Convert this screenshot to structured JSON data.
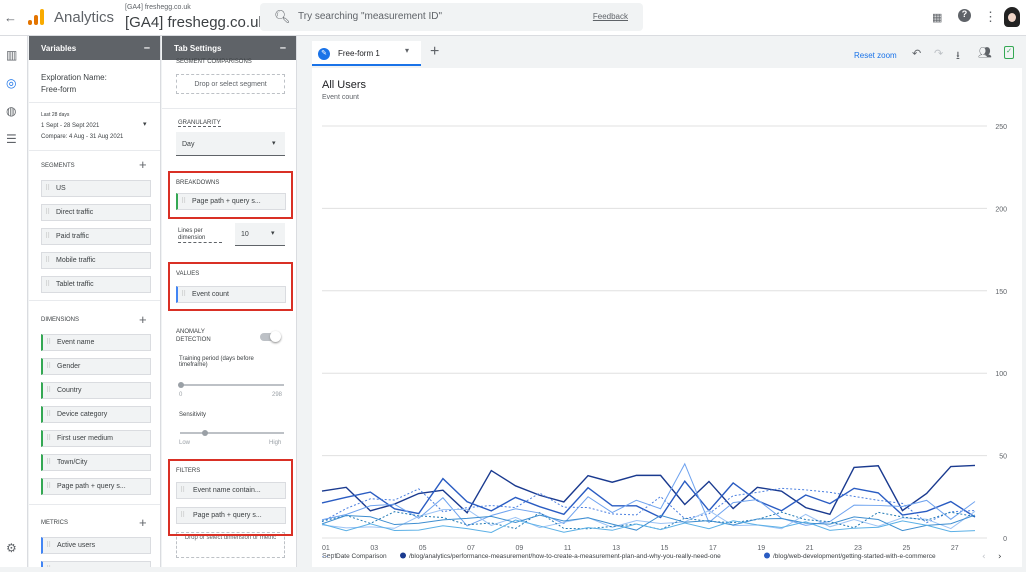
{
  "header": {
    "app_name": "Analytics",
    "account_small": "[GA4] freshegg.co.uk",
    "account": "[GA4] freshegg.co.uk",
    "search_placeholder": "Try searching \"measurement ID\"",
    "feedback": "Feedback"
  },
  "variables": {
    "title": "Variables",
    "exploration_label": "Exploration Name:",
    "exploration_value": "Free-form",
    "date_preset": "Last 28 days",
    "date_range": "1 Sept - 28 Sept 2021",
    "compare": "Compare: 4 Aug - 31 Aug 2021",
    "segments_title": "SEGMENTS",
    "segments": [
      "US",
      "Direct traffic",
      "Paid traffic",
      "Mobile traffic",
      "Tablet traffic"
    ],
    "dimensions_title": "DIMENSIONS",
    "dimensions": [
      "Event name",
      "Gender",
      "Country",
      "Device category",
      "First user medium",
      "Town/City",
      "Page path + query s..."
    ],
    "metrics_title": "METRICS",
    "metrics": [
      "Active users"
    ]
  },
  "tab_settings": {
    "title": "Tab Settings",
    "segment_comparisons": "SEGMENT COMPARISONS",
    "drop_segment": "Drop or select segment",
    "granularity": "GRANULARITY",
    "granularity_value": "Day",
    "breakdowns": "BREAKDOWNS",
    "breakdown_chip": "Page path + query s...",
    "lines_per_dimension": "Lines per dimension",
    "lines_value": "10",
    "values": "VALUES",
    "value_chip": "Event count",
    "anomaly": "ANOMALY DETECTION",
    "training": "Training period (days before timeframe)",
    "training_min": "0",
    "training_max": "298",
    "sensitivity": "Sensitivity",
    "sens_low": "Low",
    "sens_high": "High",
    "filters": "FILTERS",
    "filter1": "Event name contain...",
    "filter2": "Page path + query s...",
    "drop_filter": "Drop or select dimension or metric"
  },
  "main": {
    "tab_label": "Free-form 1",
    "reset_zoom": "Reset zoom"
  },
  "chart_data": {
    "type": "line",
    "title": "All Users",
    "ylabel": "Event count",
    "ylim": [
      0,
      250
    ],
    "y_ticks": [
      0,
      50,
      100,
      150,
      200,
      250
    ],
    "x_ticks": [
      "01 Sept",
      "03",
      "05",
      "07",
      "09",
      "11",
      "13",
      "15",
      "17",
      "19",
      "21",
      "23",
      "25",
      "27"
    ],
    "legend": [
      "Date Comparison",
      "/blog/analytics/performance-measurement/how-to-create-a-measurement-plan-and-why-you-really-need-one",
      "/blog/web-development/getting-started-with-e-commerce"
    ],
    "series_colors": [
      "#1a3a8f",
      "#2a5cc2",
      "#4a7fe0",
      "#6fa3ef",
      "#9cc3f5",
      "#1f78b4",
      "#3e8ed0",
      "#5bb0e6"
    ]
  }
}
